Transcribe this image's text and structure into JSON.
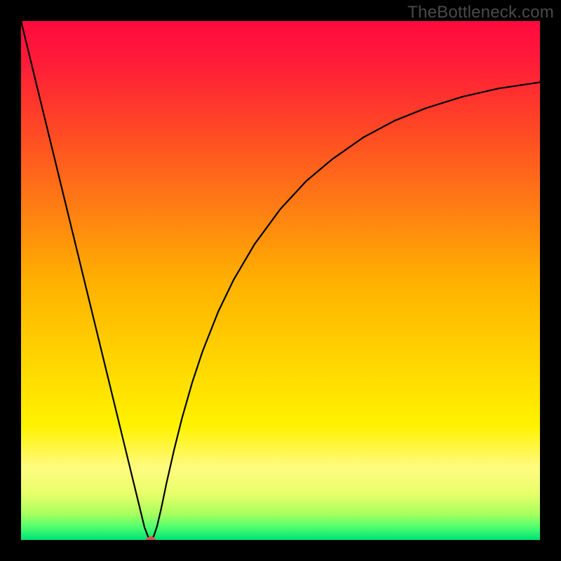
{
  "watermark": "TheBottleneck.com",
  "chart_data": {
    "type": "line",
    "title": "",
    "xlabel": "",
    "ylabel": "",
    "xlim": [
      0,
      100
    ],
    "ylim": [
      0,
      100
    ],
    "grid": false,
    "legend": false,
    "background_gradient": {
      "stops": [
        {
          "offset": 0.0,
          "color": "#ff0a3f"
        },
        {
          "offset": 0.08,
          "color": "#ff1c38"
        },
        {
          "offset": 0.2,
          "color": "#ff4526"
        },
        {
          "offset": 0.35,
          "color": "#ff7a15"
        },
        {
          "offset": 0.5,
          "color": "#ffb000"
        },
        {
          "offset": 0.65,
          "color": "#ffd400"
        },
        {
          "offset": 0.78,
          "color": "#fff200"
        },
        {
          "offset": 0.86,
          "color": "#fffb80"
        },
        {
          "offset": 0.91,
          "color": "#e9ff6a"
        },
        {
          "offset": 0.95,
          "color": "#a8ff5e"
        },
        {
          "offset": 0.975,
          "color": "#4fff6e"
        },
        {
          "offset": 1.0,
          "color": "#00e175"
        }
      ]
    },
    "series": [
      {
        "name": "bottleneck-curve",
        "stroke": "#000000",
        "stroke_width": 2.2,
        "x": [
          0,
          2,
          4,
          6,
          8,
          10,
          12,
          14,
          16,
          18,
          20,
          21,
          22,
          23,
          23.8,
          24.5,
          25,
          25.6,
          26.2,
          27,
          28,
          29.5,
          31,
          33,
          35,
          38,
          41,
          45,
          50,
          55,
          60,
          66,
          72,
          78,
          85,
          92,
          100
        ],
        "y": [
          100,
          91.8,
          83.6,
          75.4,
          67.2,
          59.0,
          50.8,
          42.6,
          34.4,
          26.2,
          18.0,
          13.9,
          9.8,
          5.7,
          2.4,
          0.6,
          0.0,
          0.8,
          2.6,
          6.0,
          10.8,
          17.4,
          23.4,
          30.4,
          36.4,
          44.0,
          50.2,
          57.0,
          63.8,
          69.2,
          73.4,
          77.6,
          80.8,
          83.2,
          85.4,
          87.0,
          88.2
        ]
      }
    ],
    "marker": {
      "name": "optimal-point",
      "x": 25,
      "y": 0,
      "rx": 7,
      "ry": 5,
      "fill": "#d1554a"
    }
  }
}
